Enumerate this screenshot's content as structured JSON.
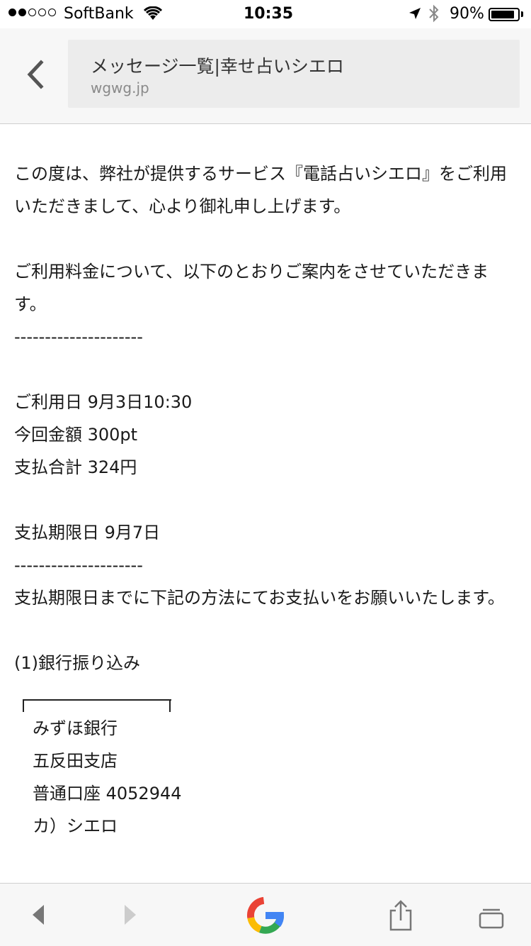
{
  "status_bar": {
    "carrier": "SoftBank",
    "time": "10:35",
    "battery_percent": "90%",
    "battery_level": 0.9,
    "signal_icon": "signal-dots-icon",
    "wifi_icon": "wifi-icon",
    "location_icon": "location-arrow-icon",
    "bluetooth_icon": "bluetooth-icon"
  },
  "header": {
    "page_title": "メッセージ一覧|幸せ占いシエロ",
    "domain": "wgwg.jp",
    "back_icon": "chevron-left-icon"
  },
  "message": {
    "p1": "この度は、弊社が提供するサービス『電話占いシエロ』をご利用いただきまして、心より御礼申し上げます。",
    "p2": "ご利用料金について、以下のとおりご案内をさせていただきます。",
    "divider1": "---------------------",
    "usage_date": "ご利用日 9月3日10:30",
    "amount": "今回金額 300pt",
    "total": "支払合計 324円",
    "due_date": "支払期限日 9月7日",
    "divider2": "---------------------",
    "instruction": "支払期限日までに下記の方法にてお支払いをお願いいたします。",
    "method_heading": "(1)銀行振り込み",
    "bank_name": "みずほ銀行",
    "branch": "五反田支店",
    "account": "普通口座 4052944",
    "account_holder": "カ）シエロ"
  },
  "toolbar": {
    "back_icon": "triangle-left-icon",
    "forward_icon": "triangle-right-icon",
    "google_icon": "google-logo-icon",
    "share_icon": "share-icon",
    "tabs_icon": "tabs-icon",
    "colors": {
      "blue": "#4285F4",
      "red": "#EA4335",
      "yellow": "#FBBC05",
      "green": "#34A853"
    }
  }
}
